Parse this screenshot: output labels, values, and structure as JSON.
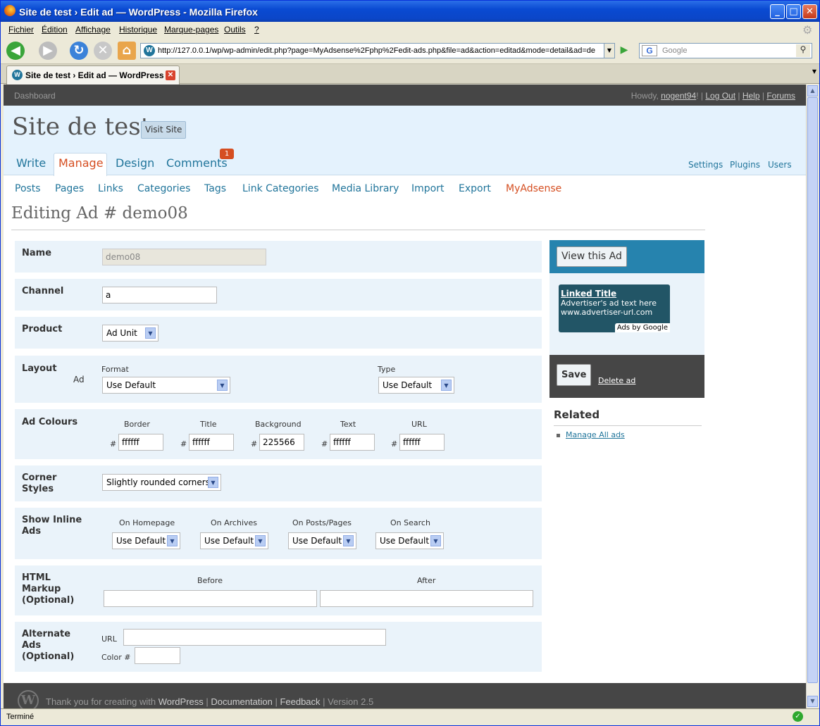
{
  "window": {
    "title": "Site de test › Edit ad — WordPress - Mozilla Firefox"
  },
  "menubar": [
    "Fichier",
    "Édition",
    "Affichage",
    "Historique",
    "Marque-pages",
    "Outils",
    "?"
  ],
  "url": "http://127.0.0.1/wp/wp-admin/edit.php?page=MyAdsense%2Fphp%2Fedit-ads.php&file=ad&action=editad&mode=detail&ad=de",
  "search": {
    "placeholder": "Google"
  },
  "tab": {
    "title": "Site de test › Edit ad — WordPress"
  },
  "status": {
    "text": "Terminé"
  },
  "wp": {
    "dashboard": "Dashboard",
    "howdy": "Howdy,",
    "user": "nogent94",
    "logout": "Log Out",
    "help": "Help",
    "forums": "Forums",
    "site_name": "Site de test",
    "visit_site": "Visit Site",
    "main_tabs": {
      "write": "Write",
      "manage": "Manage",
      "design": "Design",
      "comments": "Comments",
      "comments_count": "1"
    },
    "right_links": {
      "settings": "Settings",
      "plugins": "Plugins",
      "users": "Users"
    },
    "sub_menu": [
      "Posts",
      "Pages",
      "Links",
      "Categories",
      "Tags",
      "Link Categories",
      "Media Library",
      "Import",
      "Export",
      "MyAdsense"
    ],
    "page_title": "Editing Ad # demo08"
  },
  "form": {
    "name": {
      "label": "Name",
      "value": "demo08"
    },
    "channel": {
      "label": "Channel",
      "value": "a"
    },
    "product": {
      "label": "Product",
      "value": "Ad Unit"
    },
    "layout": {
      "label": "Layout",
      "sub": "Ad",
      "format_label": "Format",
      "format_value": "Use Default",
      "type_label": "Type",
      "type_value": "Use Default"
    },
    "colours": {
      "label": "Ad Colours",
      "hash": "#",
      "fields": [
        {
          "label": "Border",
          "value": "ffffff"
        },
        {
          "label": "Title",
          "value": "ffffff"
        },
        {
          "label": "Background",
          "value": "225566"
        },
        {
          "label": "Text",
          "value": "ffffff"
        },
        {
          "label": "URL",
          "value": "ffffff"
        }
      ]
    },
    "corner": {
      "label1": "Corner",
      "label2": "Styles",
      "value": "Slightly rounded corners"
    },
    "inline": {
      "label1": "Show Inline",
      "label2": "Ads",
      "fields": [
        {
          "label": "On Homepage",
          "value": "Use Default"
        },
        {
          "label": "On Archives",
          "value": "Use Default"
        },
        {
          "label": "On Posts/Pages",
          "value": "Use Default"
        },
        {
          "label": "On Search",
          "value": "Use Default"
        }
      ]
    },
    "html": {
      "label1": "HTML",
      "label2": "Markup",
      "label3": "(Optional)",
      "before": "Before",
      "after": "After"
    },
    "alternate": {
      "label1": "Alternate",
      "label2": "Ads",
      "label3": "(Optional)",
      "url_label": "URL",
      "color_label": "Color #"
    }
  },
  "sidebar": {
    "view_ad": "View this Ad",
    "ad_title": "Linked Title",
    "ad_text": "Advertiser's ad text here",
    "ad_url": "www.advertiser-url.com",
    "ads_by": "Ads by Google",
    "save": "Save",
    "delete": "Delete ad",
    "related": "Related",
    "manage_all": "Manage All ads"
  },
  "footer": {
    "thanks": "Thank you for creating with",
    "wordpress": "WordPress",
    "documentation": "Documentation",
    "feedback": "Feedback",
    "version": "Version 2.5"
  }
}
